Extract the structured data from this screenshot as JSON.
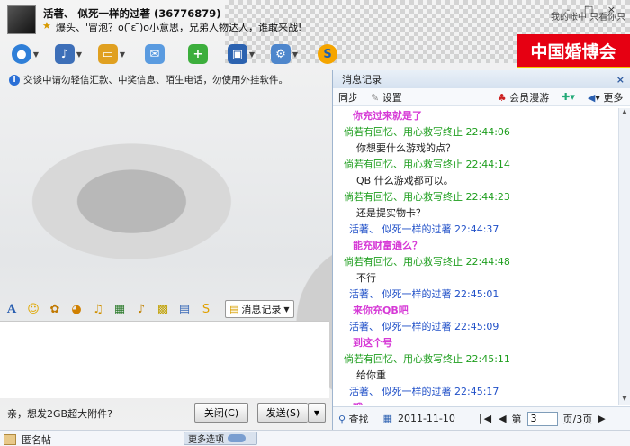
{
  "header": {
    "contact_title": "活著、 似死一样的过著 (36776879)",
    "signature": "爆头、'冒泡？o( ̄ε ̄)o小意思，兄弟人物达人，谁敢来战!",
    "ad_line": "我的帐中 只看你只",
    "window_controls": "- □ ×",
    "banner_text": "中国婚博会"
  },
  "toolbar": {
    "icons": [
      "video-call",
      "voice-call",
      "file-transfer",
      "send-email",
      "app-box",
      "display-settings",
      "more-tools",
      "softmgr"
    ]
  },
  "warning": "交谈中请勿轻信汇款、中奖信息、陌生电话，勿使用外挂软件。",
  "format_bar": {
    "message_record_label": "消息记录"
  },
  "bottom": {
    "tip": "亲，想发2GB超大附件?",
    "close_button": "关闭(C)",
    "send_button": "发送(S)",
    "send_dropdown": "▼"
  },
  "panel": {
    "title": "消息记录",
    "close": "×",
    "toolbar": {
      "sync": "同步",
      "settings": "设置",
      "vip_roam": "会员漫游",
      "more": "更多"
    },
    "messages": [
      {
        "type": "text",
        "color": "#d63ad6",
        "bold": true,
        "text": "你充过来就是了"
      },
      {
        "type": "header",
        "color": "#1e9e1e",
        "text": "倘若有回忆、用心救写终止  22:44:06"
      },
      {
        "type": "text",
        "color": "#222",
        "bold": false,
        "text": "你想要什么游戏的点？"
      },
      {
        "type": "header",
        "color": "#1e9e1e",
        "text": "倘若有回忆、用心救写终止  22:44:14"
      },
      {
        "type": "text",
        "color": "#222",
        "bold": false,
        "text": "QB 什么游戏都可以。"
      },
      {
        "type": "header",
        "color": "#1e9e1e",
        "text": "倘若有回忆、用心救写终止  22:44:23"
      },
      {
        "type": "text",
        "color": "#222",
        "bold": false,
        "text": "还是提实物卡？"
      },
      {
        "type": "header",
        "color": "#2050c8",
        "text": "活著、 似死一样的过著  22:44:37"
      },
      {
        "type": "text",
        "color": "#d63ad6",
        "bold": true,
        "text": "能充财富通么？"
      },
      {
        "type": "header",
        "color": "#1e9e1e",
        "text": "倘若有回忆、用心救写终止  22:44:48"
      },
      {
        "type": "text",
        "color": "#222",
        "bold": false,
        "text": "不行"
      },
      {
        "type": "header",
        "color": "#2050c8",
        "text": "活著、 似死一样的过著  22:45:01"
      },
      {
        "type": "text",
        "color": "#d63ad6",
        "bold": true,
        "text": "来你充QB吧"
      },
      {
        "type": "header",
        "color": "#2050c8",
        "text": "活著、 似死一样的过著  22:45:09"
      },
      {
        "type": "text",
        "color": "#d63ad6",
        "bold": true,
        "text": "到这个号"
      },
      {
        "type": "header",
        "color": "#1e9e1e",
        "text": "倘若有回忆、用心救写终止  22:45:11"
      },
      {
        "type": "text",
        "color": "#222",
        "bold": false,
        "text": "给你重"
      },
      {
        "type": "header",
        "color": "#2050c8",
        "text": "活著、 似死一样的过著  22:45:17"
      },
      {
        "type": "text",
        "color": "#d63ad6",
        "bold": true,
        "text": "哦"
      }
    ],
    "footer": {
      "search": "查找",
      "date": "2011-11-10",
      "page_label": "第",
      "page_value": "3",
      "page_total": "页/3页"
    }
  },
  "outer": {
    "anonymous": "匿名帖",
    "more_options": "更多选项"
  }
}
